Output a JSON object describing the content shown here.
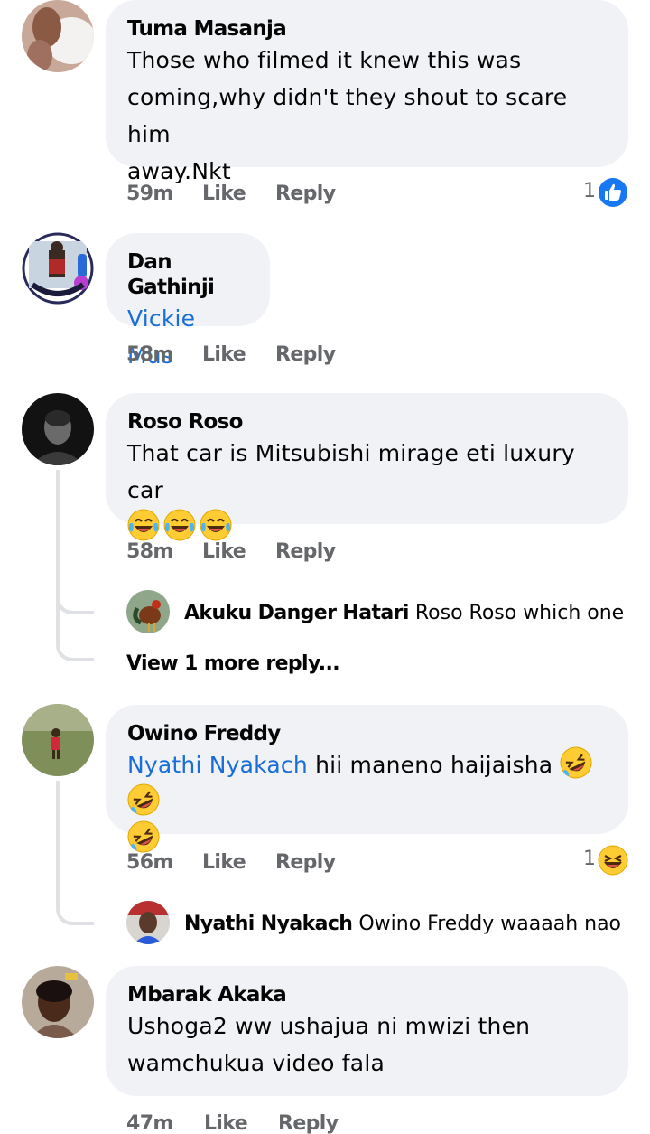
{
  "comments": [
    {
      "author": "Tuma Masanja",
      "lines": [
        "Those who filmed it knew this was",
        "coming,why didn't they shout to scare him",
        "away.Nkt"
      ],
      "time": "59m",
      "like": "Like",
      "reply": "Reply",
      "reaction_count": "1",
      "reaction": "like-icon"
    },
    {
      "author": "Dan Gathinji",
      "mention": "Vickie Mus",
      "time": "58m",
      "like": "Like",
      "reply": "Reply"
    },
    {
      "author": "Roso Roso",
      "lines": [
        "That car is Mitsubishi mirage eti luxury car"
      ],
      "emojis": "laughing-tears-emoji x3",
      "time": "58m",
      "like": "Like",
      "reply": "Reply",
      "replies": [
        {
          "author": "Akuku Danger Hatari",
          "text": "Roso Roso which one do..."
        }
      ],
      "more_replies": "View 1 more reply..."
    },
    {
      "author": "Owino Freddy",
      "mention": "Nyathi Nyakach",
      "text": "hii maneno haijaisha",
      "emojis": "rolling-laughing-emoji x3",
      "time": "56m",
      "like": "Like",
      "reply": "Reply",
      "reaction_count": "1",
      "reaction": "haha-icon",
      "replies": [
        {
          "author": "Nyathi Nyakach",
          "text": "Owino Freddy  waaaah naona..."
        }
      ]
    },
    {
      "author": "Mbarak Akaka",
      "lines": [
        "Ushoga2 ww ushajua ni mwizi then",
        "wamchukua video fala"
      ],
      "time": "47m",
      "like": "Like",
      "reply": "Reply"
    }
  ],
  "colors": {
    "bubble": "#f0f2f5",
    "mention": "#1a6ed8",
    "meta": "#65676b",
    "like_blue": "#1877f2",
    "emoji_yellow": "#ffcc33"
  }
}
